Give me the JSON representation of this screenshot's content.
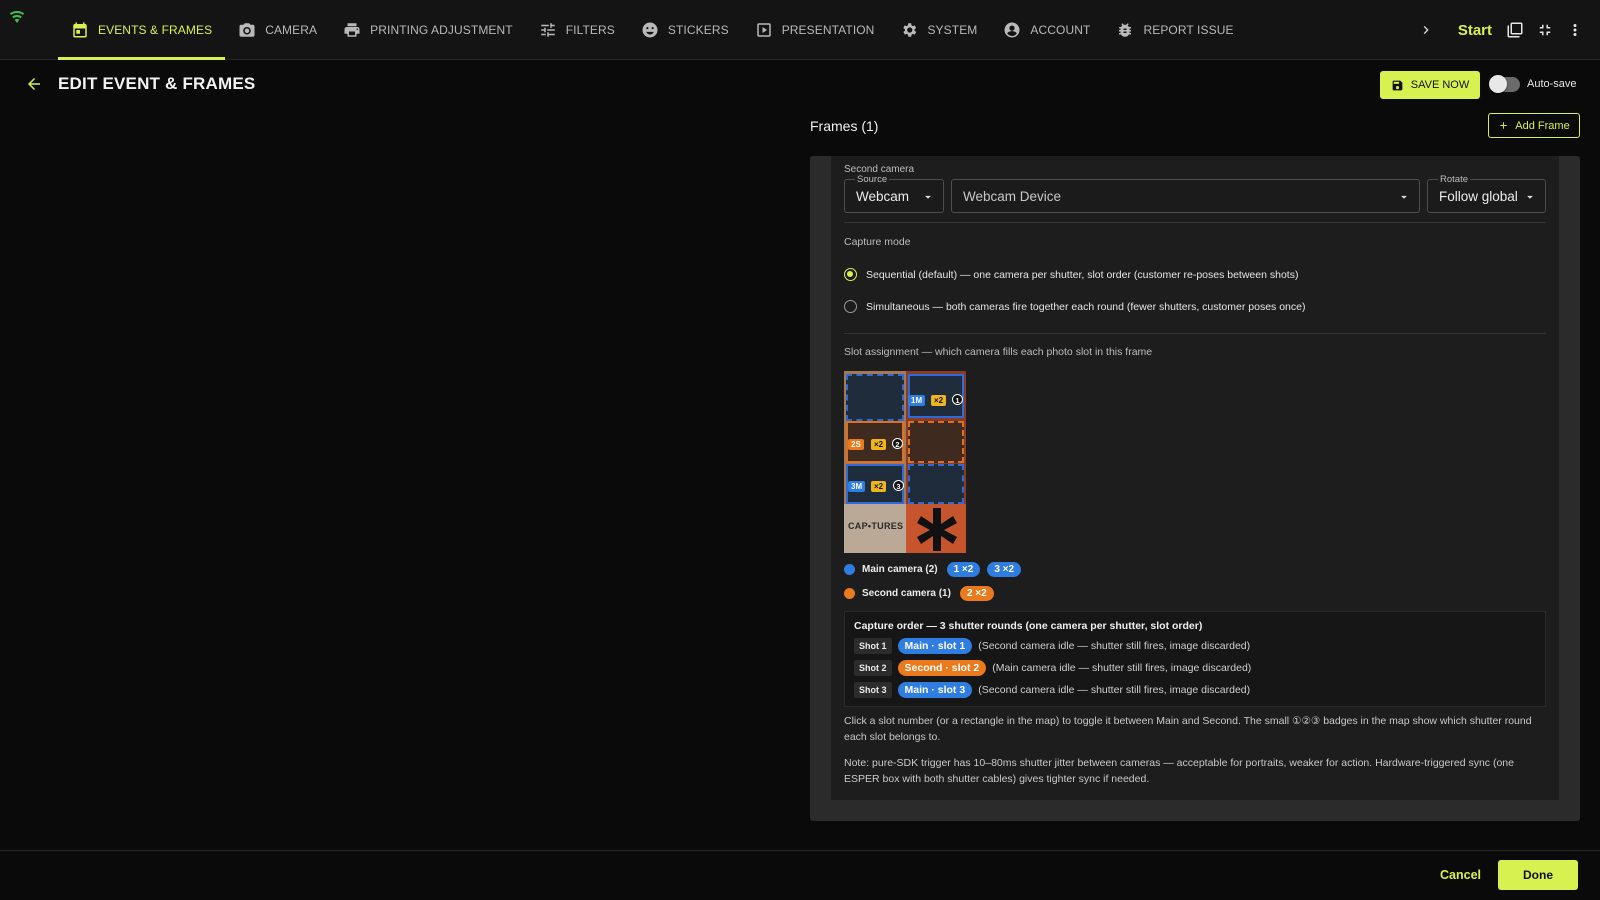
{
  "nav": {
    "items": [
      {
        "label": "EVENTS & FRAMES",
        "icon": "calendar-icon"
      },
      {
        "label": "CAMERA",
        "icon": "camera-icon"
      },
      {
        "label": "PRINTING ADJUSTMENT",
        "icon": "printer-icon"
      },
      {
        "label": "FILTERS",
        "icon": "sliders-icon"
      },
      {
        "label": "STICKERS",
        "icon": "smiley-icon"
      },
      {
        "label": "PRESENTATION",
        "icon": "play-icon"
      },
      {
        "label": "SYSTEM",
        "icon": "gear-icon"
      },
      {
        "label": "ACCOUNT",
        "icon": "account-icon"
      },
      {
        "label": "REPORT ISSUE",
        "icon": "bug-icon"
      }
    ],
    "active": "EVENTS & FRAMES",
    "start_label": "Start"
  },
  "header": {
    "title": "EDIT EVENT & FRAMES",
    "save_label": "SAVE NOW",
    "autosave_label": "Auto-save",
    "autosave_on": false
  },
  "frames": {
    "title": "Frames (1)",
    "add_label": "Add Frame"
  },
  "second_camera": {
    "section_label": "Second camera",
    "source_label": "Source",
    "source_value": "Webcam",
    "device_value": "Webcam Device",
    "rotate_label": "Rotate",
    "rotate_value": "Follow global"
  },
  "capture_mode": {
    "label": "Capture mode",
    "options": [
      {
        "label": "Sequential (default) — one camera per shutter, slot order (customer re-poses between shots)",
        "selected": true
      },
      {
        "label": "Simultaneous — both cameras fire together each round (fewer shutters, customer poses once)",
        "selected": false
      }
    ]
  },
  "slot_assignment": {
    "label": "Slot assignment — which camera fills each photo slot in this frame",
    "map_tags": {
      "slot1": "1M",
      "slot2": "2S",
      "slot3": "3M",
      "mult": "×2",
      "n1": "1",
      "n2": "2",
      "n3": "3",
      "captures_text": "CAP•TURES"
    }
  },
  "legend": {
    "main": {
      "label": "Main camera (2)",
      "pills": [
        "1 ×2",
        "3 ×2"
      ],
      "color": "#2f7de0"
    },
    "second": {
      "label": "Second camera (1)",
      "pills": [
        "2 ×2"
      ],
      "color": "#ea7a1c"
    }
  },
  "capture_order": {
    "title": "Capture order — 3 shutter rounds (one camera per shutter, slot order)",
    "shots": [
      {
        "tag": "Shot 1",
        "pill": "Main · slot 1",
        "camera": "main",
        "note": "(Second camera idle — shutter still fires, image discarded)"
      },
      {
        "tag": "Shot 2",
        "pill": "Second · slot 2",
        "camera": "second",
        "note": "(Main camera idle — shutter still fires, image discarded)"
      },
      {
        "tag": "Shot 3",
        "pill": "Main · slot 3",
        "camera": "main",
        "note": "(Second camera idle — shutter still fires, image discarded)"
      }
    ]
  },
  "help_text": "Click a slot number (or a rectangle in the map) to toggle it between Main and Second. The small ①②③ badges in the map show which shutter round each slot belongs to.",
  "note_text": "Note: pure-SDK trigger has 10–80ms shutter jitter between cameras — acceptable for portraits, weaker for action. Hardware-triggered sync (one ESPER box with both shutter cables) gives tighter sync if needed.",
  "footer": {
    "cancel_label": "Cancel",
    "done_label": "Done"
  },
  "colors": {
    "accent": "#d7f250",
    "main_camera": "#2f7de0",
    "second_camera": "#ea7a1c"
  }
}
